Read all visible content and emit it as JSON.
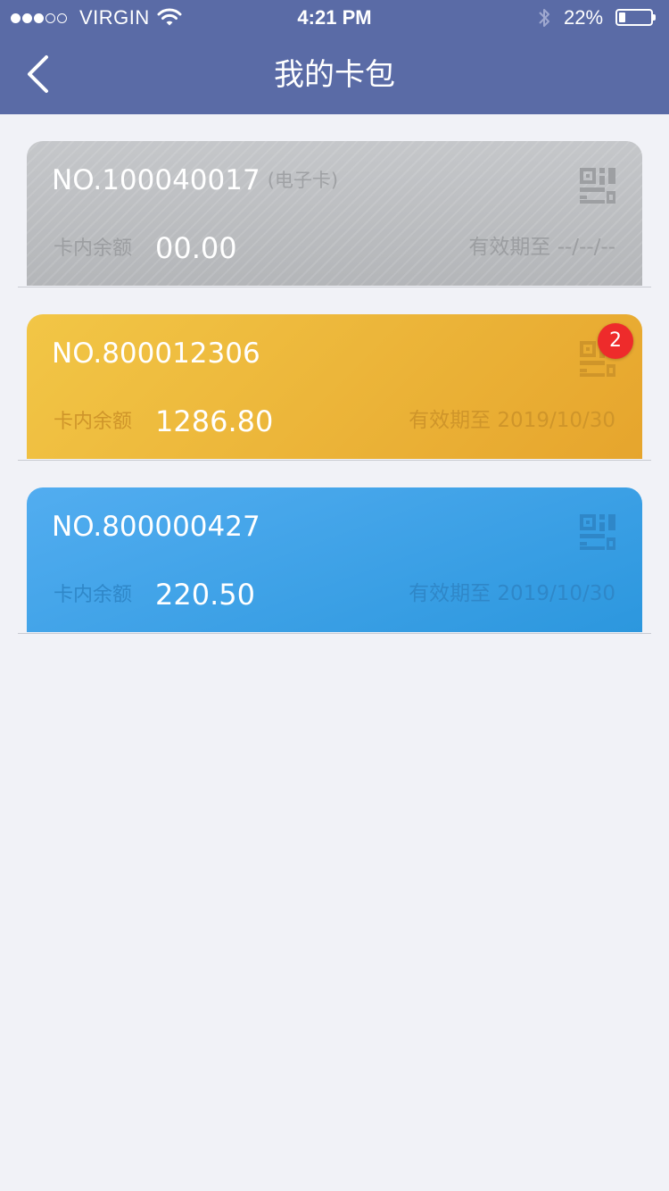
{
  "status_bar": {
    "signal_dots": [
      "on",
      "on",
      "on",
      "off",
      "off"
    ],
    "carrier": "VIRGIN",
    "time": "4:21 PM",
    "battery_percent_text": "22%",
    "battery_level": 0.22
  },
  "nav": {
    "title": "我的卡包",
    "back_icon": "chevron-left-icon"
  },
  "colors": {
    "header_bg": "#5a6ba6",
    "page_bg": "#f1f2f7",
    "badge": "#ee2b2b"
  },
  "cards": [
    {
      "theme": "gray",
      "number": "NO.100040017",
      "tag": "(电子卡)",
      "balance_label": "卡内余额",
      "balance": "00.00",
      "expiry_label": "有效期至",
      "expiry": "--/--/--",
      "qr_icon": "qr-code-icon",
      "badge": null
    },
    {
      "theme": "yellow",
      "number": "NO.800012306",
      "tag": "",
      "balance_label": "卡内余额",
      "balance": "1286.80",
      "expiry_label": "有效期至",
      "expiry": "2019/10/30",
      "qr_icon": "qr-code-icon",
      "badge": "2"
    },
    {
      "theme": "blue",
      "number": "NO.800000427",
      "tag": "",
      "balance_label": "卡内余额",
      "balance": "220.50",
      "expiry_label": "有效期至",
      "expiry": "2019/10/30",
      "qr_icon": "qr-code-icon",
      "badge": null
    }
  ]
}
